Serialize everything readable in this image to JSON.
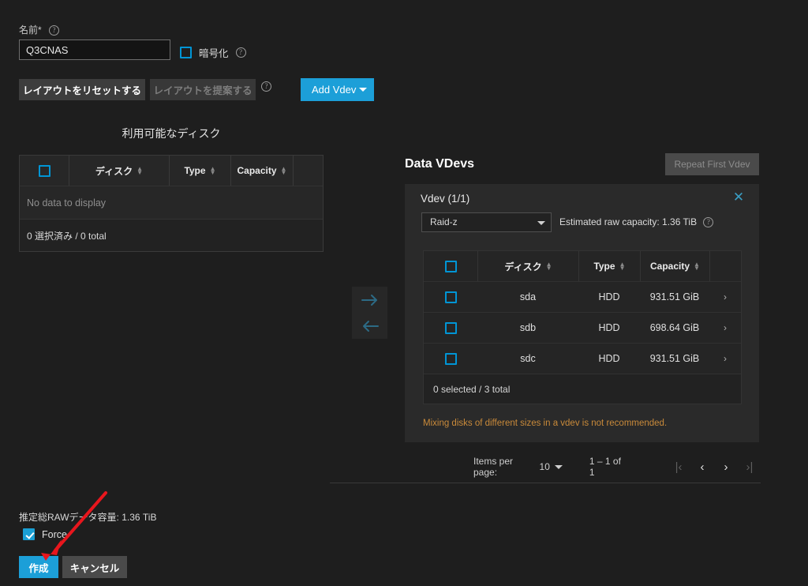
{
  "form": {
    "name_label": "名前*",
    "name_value": "Q3CNAS",
    "encryption_label": "暗号化"
  },
  "toolbar": {
    "reset_layout": "レイアウトをリセットする",
    "suggest_layout": "レイアウトを提案する",
    "add_vdev": "Add Vdev"
  },
  "available": {
    "title": "利用可能なディスク",
    "columns": [
      "ディスク",
      "Type",
      "Capacity"
    ],
    "empty_text": "No data to display",
    "footer": "0 選択済み / 0 total"
  },
  "vdevs": {
    "section_title": "Data VDevs",
    "repeat_button": "Repeat First Vdev",
    "card_title": "Vdev (1/1)",
    "raid_level": "Raid-z",
    "estimated_capacity": "Estimated raw capacity: 1.36 TiB",
    "columns": [
      "ディスク",
      "Type",
      "Capacity"
    ],
    "rows": [
      {
        "disk": "sda",
        "type": "HDD",
        "capacity": "931.51 GiB",
        "chevron": "›"
      },
      {
        "disk": "sdb",
        "type": "HDD",
        "capacity": "698.64 GiB",
        "chevron": "›"
      },
      {
        "disk": "sdc",
        "type": "HDD",
        "capacity": "931.51 GiB",
        "chevron": "›"
      }
    ],
    "footer": "0 selected / 3 total",
    "warning": "Mixing disks of different sizes in a vdev is not recommended.",
    "close_glyph": "✕"
  },
  "pagination": {
    "items_per_page_label": "Items per page:",
    "items_per_page_value": "10",
    "range": "1 – 1 of 1",
    "first_glyph": "|‹",
    "prev_glyph": "‹",
    "next_glyph": "›",
    "last_glyph": "›|"
  },
  "bottom": {
    "raw_total": "推定総RAWデータ容量: 1.36 TiB",
    "force_label": "Force",
    "create_button": "作成",
    "cancel_button": "キャンセル"
  },
  "colors": {
    "accent": "#1c9fd8",
    "checkbox": "#0095d5",
    "warning": "#c98a3a",
    "annotation": "#e8161d",
    "background": "#1e1e1e"
  }
}
